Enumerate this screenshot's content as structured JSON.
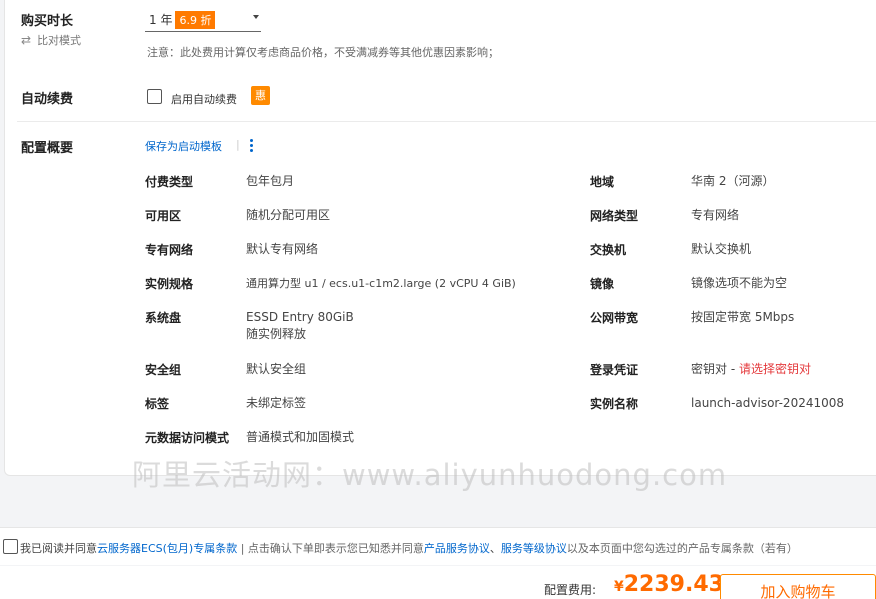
{
  "purchase": {
    "duration_label": "购买时长",
    "compare_mode": "比对模式",
    "duration_value": "1 年",
    "discount": "6.9 折",
    "note": "注意：此处费用计算仅考虑商品价格，不受满减券等其他优惠因素影响；"
  },
  "auto_renew": {
    "label": "自动续费",
    "checkbox_label": "启用自动续费",
    "badge": "惠"
  },
  "config": {
    "title": "配置概要",
    "save_template": "保存为启动模板",
    "separator": "|",
    "left_items": [
      {
        "label": "付费类型",
        "value": "包年包月"
      },
      {
        "label": "可用区",
        "value": "随机分配可用区"
      },
      {
        "label": "专有网络",
        "value": "默认专有网络"
      },
      {
        "label": "实例规格",
        "value": "通用算力型 u1 / ecs.u1-c1m2.large (2 vCPU 4 GiB)"
      },
      {
        "label": "系统盘",
        "value": "ESSD Entry 80GiB",
        "value2": "随实例释放"
      },
      {
        "label": "安全组",
        "value": "默认安全组"
      },
      {
        "label": "标签",
        "value": "未绑定标签"
      },
      {
        "label": "元数据访问模式",
        "value": "普通模式和加固模式"
      }
    ],
    "right_items": [
      {
        "label": "地域",
        "value": "华南 2（河源）"
      },
      {
        "label": "网络类型",
        "value": "专有网络"
      },
      {
        "label": "交换机",
        "value": "默认交换机"
      },
      {
        "label": "镜像",
        "value": "镜像选项不能为空"
      },
      {
        "label": "公网带宽",
        "value": "按固定带宽 5Mbps"
      },
      {
        "label": "登录凭证",
        "value": "密钥对 - ",
        "value_link": "请选择密钥对"
      },
      {
        "label": "实例名称",
        "value": "launch-advisor-20241008"
      }
    ]
  },
  "watermark": "阿里云活动网：www.aliyunhuodong.com",
  "agreement": {
    "prefix": "我已阅读并同意",
    "terms_link": "云服务器ECS(包月)专属条款",
    "middle": "| 点击确认下单即表示您已知悉并同意",
    "product_link": "产品服务协议",
    "comma": "、",
    "sla_link": "服务等级协议",
    "suffix": "以及本页面中您勾选过的产品专属条款（若有）"
  },
  "footer": {
    "price_label": "配置费用:",
    "currency": "¥",
    "price": "2239.43",
    "cart_button": "加入购物车"
  },
  "colors": {
    "accent": "#ff6a00",
    "link": "#0066cc",
    "error": "#e4393c"
  }
}
